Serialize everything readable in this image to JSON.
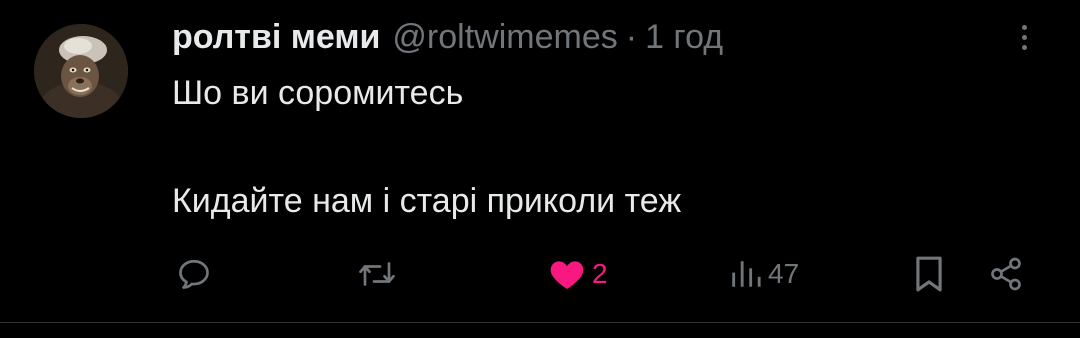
{
  "tweet": {
    "display_name": "ролтві меми",
    "handle": "@roltwimemes",
    "separator": "·",
    "time": "1 год",
    "text_lines": [
      "Шо ви соромитесь",
      "Кидайте нам і старі приколи теж"
    ]
  },
  "actions": {
    "reply": {
      "icon": "reply-icon"
    },
    "retweet": {
      "icon": "retweet-icon"
    },
    "like": {
      "icon": "heart-filled-icon",
      "count": "2",
      "active": true
    },
    "views": {
      "icon": "views-chart-icon",
      "count": "47"
    },
    "bookmark": {
      "icon": "bookmark-icon"
    },
    "share": {
      "icon": "share-icon"
    }
  },
  "colors": {
    "background": "#000000",
    "text": "#e7e9ea",
    "muted": "#71767b",
    "like": "#f91880",
    "divider": "#2f3336"
  }
}
